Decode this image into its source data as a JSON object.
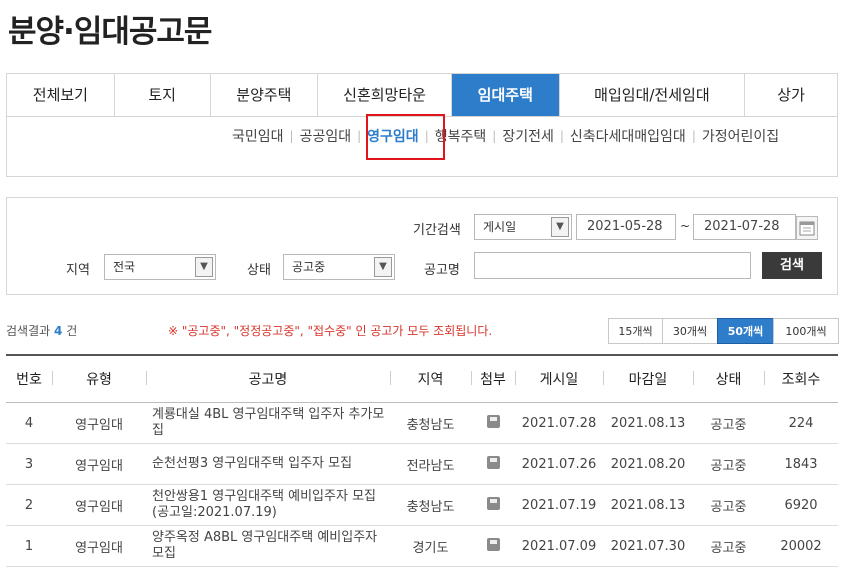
{
  "page_title": "분양·임대공고문",
  "main_tabs": [
    {
      "label": "전체보기"
    },
    {
      "label": "토지"
    },
    {
      "label": "분양주택"
    },
    {
      "label": "신혼희망타운"
    },
    {
      "label": "임대주택"
    },
    {
      "label": "매입임대/전세임대"
    },
    {
      "label": "상가"
    }
  ],
  "sub_tabs": [
    {
      "label": "국민임대"
    },
    {
      "label": "공공임대"
    },
    {
      "label": "영구임대"
    },
    {
      "label": "행복주택"
    },
    {
      "label": "장기전세"
    },
    {
      "label": "신축다세대매입임대"
    },
    {
      "label": "가정어린이집"
    }
  ],
  "search": {
    "period_label": "기간검색",
    "period_select": "게시일",
    "date_from": "2021-05-28",
    "date_sep": "~",
    "date_to": "2021-07-28",
    "region_label": "지역",
    "region_select": "전국",
    "status_label": "상태",
    "status_select": "공고중",
    "name_label": "공고명",
    "name_value": "",
    "button_label": "검색"
  },
  "results": {
    "count_prefix": "검색결과",
    "count": "4",
    "count_suffix": "건",
    "notice": "※ \"공고중\", \"정정공고중\", \"접수중\" 인 공고가 모두 조회됩니다."
  },
  "per_page": [
    {
      "label": "15개씩"
    },
    {
      "label": "30개씩"
    },
    {
      "label": "50개씩"
    },
    {
      "label": "100개씩"
    }
  ],
  "table": {
    "headers": [
      "번호",
      "유형",
      "공고명",
      "지역",
      "첨부",
      "게시일",
      "마감일",
      "상태",
      "조회수"
    ],
    "rows": [
      {
        "no": "4",
        "type": "영구임대",
        "title": "계룡대실 4BL 영구임대주택 입주자 추가모집",
        "region": "충청남도",
        "posted": "2021.07.28",
        "deadline": "2021.08.13",
        "status": "공고중",
        "views": "224"
      },
      {
        "no": "3",
        "type": "영구임대",
        "title": "순천선평3 영구임대주택 입주자 모집",
        "region": "전라남도",
        "posted": "2021.07.26",
        "deadline": "2021.08.20",
        "status": "공고중",
        "views": "1843"
      },
      {
        "no": "2",
        "type": "영구임대",
        "title": "천안쌍용1 영구임대주택 예비입주자 모집(공고일:2021.07.19)",
        "region": "충청남도",
        "posted": "2021.07.19",
        "deadline": "2021.08.13",
        "status": "공고중",
        "views": "6920"
      },
      {
        "no": "1",
        "type": "영구임대",
        "title": "양주옥정 A8BL 영구임대주택 예비입주자 모집",
        "region": "경기도",
        "posted": "2021.07.09",
        "deadline": "2021.07.30",
        "status": "공고중",
        "views": "20002"
      }
    ]
  },
  "icons": {
    "attachment": "floppy-disk-icon",
    "calendar": "calendar-icon",
    "dropdown": "chevron-down-icon"
  },
  "colors": {
    "accent": "#2d7dcb",
    "highlight": "#e0141b",
    "notice": "#d9342b"
  }
}
